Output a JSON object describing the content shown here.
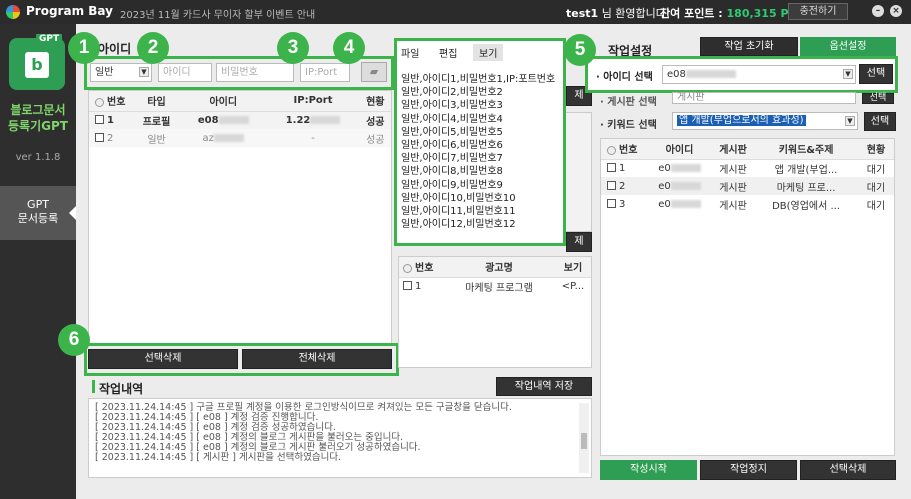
{
  "titlebar": {
    "app_name": "Program Bay",
    "notice": "2023년 11월 카드사 무이자 할부 이벤트 안내",
    "user": "test1",
    "welcome_suffix": "님 환영합니다!",
    "points_label": "잔여 포인트 :",
    "points_value": "180,315 P",
    "charge_label": "충전하기",
    "minimize_icon": "minimize-icon",
    "close_icon": "close-icon"
  },
  "sidebar": {
    "gpt_badge": "GPT",
    "app_title_line1": "블로그문서",
    "app_title_line2": "등록기GPT",
    "version": "ver 1.1.8",
    "menu_line1": "GPT",
    "menu_line2": "문서등록"
  },
  "account_form": {
    "title": "아이디",
    "type_value": "일반",
    "id_placeholder": "아이디",
    "pw_placeholder": "비밀번호",
    "ip_placeholder": "IP:Port",
    "folder_icon": "folder-open-icon"
  },
  "account_table": {
    "headers": [
      "번호",
      "타입",
      "아이디",
      "IP:Port",
      "현황"
    ],
    "rows": [
      {
        "num": "1",
        "type": "프로필",
        "id": "e08",
        "ip": "1.22",
        "status": "성공"
      },
      {
        "num": "2",
        "type": "일반",
        "id": "az",
        "ip": "-",
        "status": "성공"
      }
    ]
  },
  "account_buttons": {
    "delete_selected": "선택삭제",
    "delete_all": "전체삭제"
  },
  "file_popup": {
    "menu": [
      "파일",
      "편집",
      "보기"
    ],
    "lines": [
      "일반,아이디1,비밀번호1,IP:포트번호",
      "일반,아이디2,비밀번호2",
      "일반,아이디3,비밀번호3",
      "일반,아이디4,비밀번호4",
      "일반,아이디5,비밀번호5",
      "일반,아이디6,비밀번호6",
      "일반,아이디7,비밀번호7",
      "일반,아이디8,비밀번호8",
      "일반,아이디9,비밀번호9",
      "일반,아이디10,비밀번호10",
      "일반,아이디11,비밀번호11",
      "일반,아이디12,비밀번호12"
    ]
  },
  "side_buttons": {
    "b1": "제",
    "b2": "제"
  },
  "ad_table": {
    "headers": [
      "번호",
      "광고명",
      "보기"
    ],
    "rows": [
      {
        "num": "1",
        "name": "마케팅 프로그램",
        "view": "<P..."
      }
    ]
  },
  "task_settings": {
    "title": "작업설정",
    "reset_label": "작업 초기화",
    "options_label": "옵션설정",
    "id_select_label": "아이디 선택",
    "id_select_value": "e08",
    "select_btn": "선택",
    "board_label": "게시판 선택",
    "board_value": "게시판",
    "keyword_label": "키워드 선택",
    "keyword_value": "앱 개발(부업으로서의 효과성)"
  },
  "task_table": {
    "headers": [
      "번호",
      "아이디",
      "게시판",
      "키워드&주제",
      "현황"
    ],
    "rows": [
      {
        "num": "1",
        "id": "e0",
        "board": "게시판",
        "keyword": "앱 개발(부업...",
        "status": "대기"
      },
      {
        "num": "2",
        "id": "e0",
        "board": "게시판",
        "keyword": "마케팅 프로...",
        "status": "대기"
      },
      {
        "num": "3",
        "id": "e0",
        "board": "게시판",
        "keyword": "DB(영업에서 ...",
        "status": "대기"
      }
    ]
  },
  "task_buttons": {
    "start": "작성시작",
    "stop": "작업정지",
    "delete_selected": "선택삭제"
  },
  "log": {
    "title": "작업내역",
    "save_label": "작업내역 저장",
    "lines": [
      "[ 2023.11.24.14:45 ] 구글 프로필 계정을 이용한 로그인방식이므로 켜져있는 모든 구글창을 닫습니다.",
      "[ 2023.11.24.14:45 ] [ e08 ] 계정 검증 진행합니다.",
      "[ 2023.11.24.14:45 ] [ e08 ] 계정 검증 성공하였습니다.",
      "[ 2023.11.24.14:45 ] [ e08 ] 계정의 블로그 게시판을 불러오는 중입니다.",
      "[ 2023.11.24.14:45 ] [ e08 ] 계정의 블로그 게시판 불러오기 성공하였습니다.",
      "[ 2023.11.24.14:45 ] [ 게시판 ] 게시판을 선택하였습니다."
    ]
  },
  "badges": [
    "1",
    "2",
    "3",
    "4",
    "5",
    "6"
  ],
  "colors": {
    "accent": "#3cb44b",
    "brand": "#2f9e55",
    "titlebar": "#2b2b2b"
  }
}
